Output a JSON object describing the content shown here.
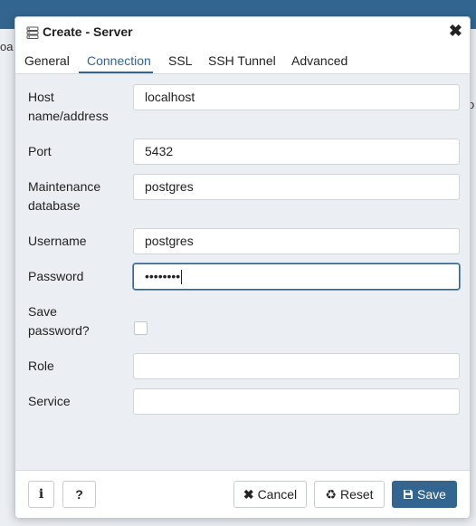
{
  "background": {
    "left_text": "oa",
    "right_text": "o"
  },
  "dialog": {
    "title": "Create - Server",
    "title_icon": "server-icon",
    "close_symbol": "✖"
  },
  "tabs": [
    {
      "label": "General",
      "active": false
    },
    {
      "label": "Connection",
      "active": true
    },
    {
      "label": "SSL",
      "active": false
    },
    {
      "label": "SSH Tunnel",
      "active": false
    },
    {
      "label": "Advanced",
      "active": false
    }
  ],
  "form": {
    "host": {
      "label_line1": "Host",
      "label_line2": "name/address",
      "value": "localhost"
    },
    "port": {
      "label": "Port",
      "value": "5432"
    },
    "maintenance_db": {
      "label_line1": "Maintenance",
      "label_line2": "database",
      "value": "postgres"
    },
    "username": {
      "label": "Username",
      "value": "postgres"
    },
    "password": {
      "label": "Password",
      "masked_value": "••••••••"
    },
    "save_password": {
      "label_line1": "Save",
      "label_line2": "password?",
      "checked": false
    },
    "role": {
      "label": "Role",
      "value": ""
    },
    "service": {
      "label": "Service",
      "value": ""
    }
  },
  "footer": {
    "info_symbol": "i",
    "help_symbol": "?",
    "cancel_label": "Cancel",
    "cancel_icon": "close-icon",
    "reset_label": "Reset",
    "reset_icon": "recycle-icon",
    "save_label": "Save",
    "save_icon": "floppy-disk-icon"
  },
  "colors": {
    "accent": "#326690",
    "form_background": "#ebeef3"
  }
}
